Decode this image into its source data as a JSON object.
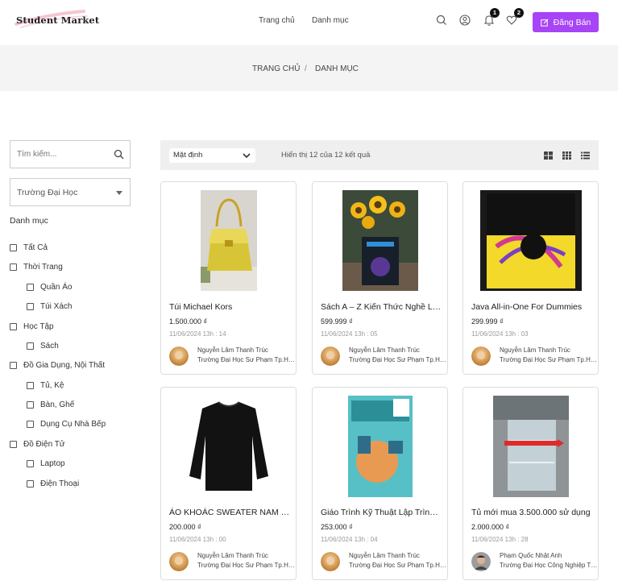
{
  "header": {
    "logo": "Student Market",
    "nav": [
      "Trang chủ",
      "Danh mục"
    ],
    "notification_count": "1",
    "favorite_count": "2",
    "sell_button": "Đăng Bán"
  },
  "breadcrumb": {
    "home": "TRANG CHỦ",
    "separator": "/",
    "current": "DANH MỤC"
  },
  "sidebar": {
    "search_placeholder": "Tìm kiếm...",
    "university_select": "Trường Đại Học",
    "category_title": "Danh mục",
    "categories": [
      "Tất Cả",
      "Thời Trang",
      "Quần Áo",
      "Túi Xách",
      "Học Tập",
      "Sách",
      "Đồ Gia Dụng, Nội Thất",
      "Tủ, Kệ",
      "Bàn, Ghế",
      "Dụng Cụ Nhà Bếp",
      "Đồ Điện Tử",
      "Laptop",
      "Điện Thoại"
    ]
  },
  "toolbar": {
    "sort": "Mặt định",
    "result_text": "Hiển thị 12 của 12 kết quả"
  },
  "products": [
    {
      "title": "Túi Michael Kors",
      "price": "1.500.000 ₫",
      "date": "11/06/2024 13h : 14",
      "seller": "Nguyễn Lâm Thanh Trúc",
      "school": "Trường Đại Học Sư Phạm Tp.HCM"
    },
    {
      "title": "Sách A – Z Kiến Thức Nghề Lập Trình",
      "price": "599.999 ₫",
      "date": "11/06/2024 13h : 05",
      "seller": "Nguyễn Lâm Thanh Trúc",
      "school": "Trường Đại Học Sư Phạm Tp.HCM"
    },
    {
      "title": "Java All-in-One For Dummies",
      "price": "299.999 ₫",
      "date": "11/06/2024 13h : 03",
      "seller": "Nguyễn Lâm Thanh Trúc",
      "school": "Trường Đại Học Sư Phạm Tp.HCM"
    },
    {
      "title": "ÁO KHOÁC SWEATER NAM NỮ",
      "price": "200.000 ₫",
      "date": "11/06/2024 13h : 00",
      "seller": "Nguyễn Lâm Thanh Trúc",
      "school": "Trường Đại Học Sư Phạm Tp.HCM"
    },
    {
      "title": "Giáo Trình Kỹ Thuật Lập Trình C",
      "price": "253.000 ₫",
      "date": "11/06/2024 13h : 04",
      "seller": "Nguyễn Lâm Thanh Trúc",
      "school": "Trường Đại Học Sư Phạm Tp.HCM"
    },
    {
      "title": "Tủ mới mua 3.500.000 sử dụng",
      "price": "2.000.000 ₫",
      "date": "11/06/2024 13h : 28",
      "seller": "Phạm Quốc Nhật Anh",
      "school": "Trường Đại Học Công Nghiệp Tp.HCM"
    }
  ],
  "colors": {
    "accent": "#a744f5",
    "breadcrumb_bg": "#f4f4f4",
    "toolbar_bg": "#efefef"
  }
}
